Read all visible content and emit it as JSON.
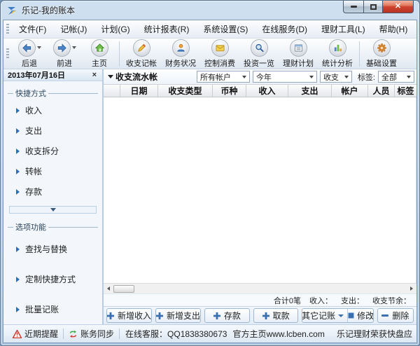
{
  "window": {
    "title": "乐记-我的账本"
  },
  "colors": {
    "accent_blue": "#3a6fb0",
    "warning_red": "#e03c31",
    "sync_green": "#3aa93f",
    "close_red": "#cf4530"
  },
  "menu": {
    "items": [
      {
        "label": "文件(F)"
      },
      {
        "label": "记帐(J)"
      },
      {
        "label": "计划(G)"
      },
      {
        "label": "统计报表(R)"
      },
      {
        "label": "系统设置(S)"
      },
      {
        "label": "在线服务(D)"
      },
      {
        "label": "理财工具(L)"
      },
      {
        "label": "帮助(H)"
      }
    ]
  },
  "toolbar": {
    "items": [
      {
        "label": "后退",
        "icon": "back-arrow"
      },
      {
        "label": "前进",
        "icon": "forward-arrow"
      },
      {
        "label": "主页",
        "icon": "home"
      },
      {
        "label": "收支记帐",
        "icon": "pencil"
      },
      {
        "label": "财务状况",
        "icon": "person"
      },
      {
        "label": "控制消费",
        "icon": "envelope"
      },
      {
        "label": "投资一览",
        "icon": "magnifier"
      },
      {
        "label": "理财计划",
        "icon": "calendar"
      },
      {
        "label": "统计分析",
        "icon": "bar-chart"
      },
      {
        "label": "基础设置",
        "icon": "gear"
      }
    ]
  },
  "sidebar": {
    "date": "2013年07月16日",
    "groups": [
      {
        "title": "快捷方式",
        "items": [
          {
            "label": "收入"
          },
          {
            "label": "支出"
          },
          {
            "label": "收支拆分"
          },
          {
            "label": "转帐"
          },
          {
            "label": "存款"
          }
        ]
      },
      {
        "title": "选项功能",
        "items": [
          {
            "label": "查找与替换"
          },
          {
            "label": "定制快捷方式"
          },
          {
            "label": "批量记账"
          }
        ]
      }
    ]
  },
  "main": {
    "panel_title": "收支流水帐",
    "filters": {
      "account": "所有帐户",
      "period": "今年",
      "type": "收支",
      "tag_label": "标签:",
      "tag": "全部"
    },
    "table": {
      "columns": [
        {
          "label": "日期"
        },
        {
          "label": "收支类型"
        },
        {
          "label": "币种"
        },
        {
          "label": "收入"
        },
        {
          "label": "支出"
        },
        {
          "label": "帐户"
        },
        {
          "label": "人员"
        },
        {
          "label": "标签"
        }
      ]
    },
    "summary": {
      "total": "合计0笔",
      "income_label": "收入：",
      "expense_label": "支出：",
      "balance_label": "收支节余："
    },
    "actions": [
      {
        "label": "新增收入"
      },
      {
        "label": "新增支出"
      },
      {
        "label": "存款"
      },
      {
        "label": "取款"
      },
      {
        "label": "其它记账"
      },
      {
        "label": "修改"
      },
      {
        "label": "删除"
      }
    ]
  },
  "statusbar": {
    "reminder": "近期提醒",
    "sync": "账务同步",
    "service": "在线客服：QQ1838380673",
    "homepage": "官方主页www.lcben.com",
    "promo": "乐记理财荣获快盘应"
  }
}
